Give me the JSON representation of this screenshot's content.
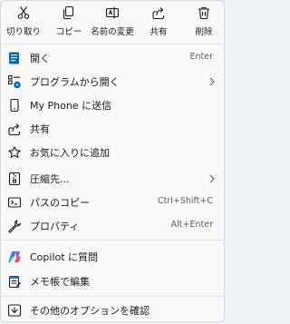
{
  "toolbar": {
    "items": [
      {
        "label": "切り取り",
        "icon": "scissors-icon"
      },
      {
        "label": "コピー",
        "icon": "copy-icon"
      },
      {
        "label": "名前の変更",
        "icon": "rename-icon"
      },
      {
        "label": "共有",
        "icon": "share-icon"
      },
      {
        "label": "削除",
        "icon": "trash-icon"
      }
    ]
  },
  "menu": {
    "items": [
      {
        "label": "開く",
        "shortcut": "Enter",
        "icon": "open-icon"
      },
      {
        "label": "プログラムから開く",
        "icon": "open-with-icon",
        "submenu": true
      },
      {
        "label": "My Phone に送信",
        "icon": "phone-icon"
      },
      {
        "label": "共有",
        "icon": "share-icon"
      },
      {
        "label": "お気に入りに追加",
        "icon": "star-icon"
      },
      {
        "label": "圧縮先...",
        "icon": "zip-icon",
        "submenu": true
      },
      {
        "label": "パスのコピー",
        "shortcut": "Ctrl+Shift+C",
        "icon": "copy-path-icon"
      },
      {
        "label": "プロパティ",
        "shortcut": "Alt+Enter",
        "icon": "wrench-icon"
      },
      {
        "label": "Copilot に質問",
        "icon": "copilot-icon"
      },
      {
        "label": "メモ帳で編集",
        "icon": "notepad-icon"
      },
      {
        "label": "その他のオプションを確認",
        "icon": "more-options-icon"
      }
    ]
  },
  "colors": {
    "accent": "#0067c0",
    "text": "#1a1a1a",
    "shortcut_text": "#5f5f5f",
    "background": "#f9f9f9"
  }
}
